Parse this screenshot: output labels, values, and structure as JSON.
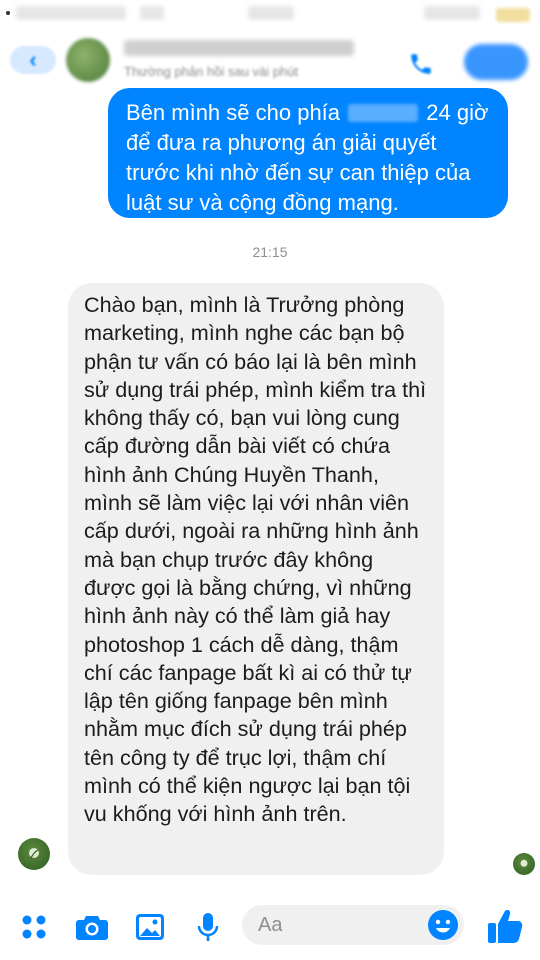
{
  "header": {
    "contact_status": "Thường phản hồi sau vài phút",
    "back_symbol": "‹"
  },
  "messages": {
    "outgoing": {
      "line1_before": "Bên mình sẽ cho phía",
      "line1_after": "24 giờ",
      "rest": "để đưa ra phương án giải quyết trước khi nhờ đến sự can thiệp của luật sư và cộng đồng mạng."
    },
    "timestamp": "21:15",
    "incoming": "Chào bạn, mình là Trưởng phòng marketing, mình nghe các bạn bộ phận tư vấn có báo lại là bên mình sử dụng trái phép, mình kiểm tra thì không thấy có, bạn vui lòng cung cấp đường dẫn bài viết có chứa hình ảnh Chúng Huyền Thanh, mình sẽ làm việc lại với nhân viên cấp dưới, ngoài ra những hình ảnh mà bạn chụp trước đây không được gọi là bằng chứng, vì những hình ảnh này có thể làm giả hay photoshop 1 cách dễ dàng, thậm chí các fanpage bất kì ai có thử tự lập tên giống fanpage bên mình nhằm mục đích sử dụng trái phép tên công ty để trục lợi, thậm chí mình có thể kiện ngược lại bạn tội vu khống với hình ảnh trên."
  },
  "composer": {
    "placeholder": "Aa"
  },
  "icons": {
    "apps": "apps-grid-icon",
    "camera": "camera-icon",
    "gallery": "photo-gallery-icon",
    "mic": "microphone-icon",
    "emoji": "emoji-icon",
    "like": "thumbs-up-icon",
    "phone": "phone-icon",
    "video": "video-call-icon"
  },
  "colors": {
    "accent": "#0084ff",
    "incoming_bubble": "#f1f0f0",
    "timestamp": "#8e8e93"
  }
}
